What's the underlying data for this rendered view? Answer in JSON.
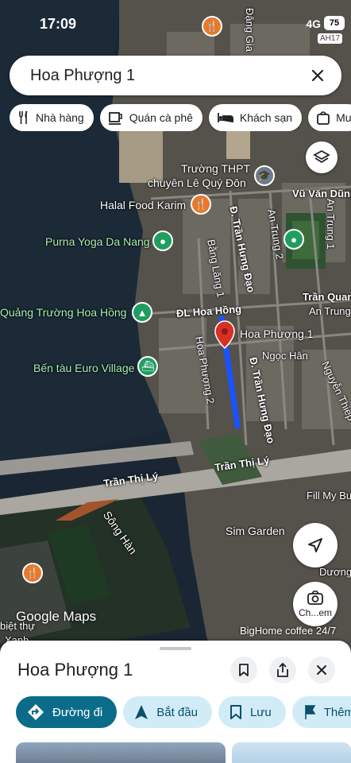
{
  "status_bar": {
    "time": "17:09",
    "network": "4G",
    "battery": "75"
  },
  "search": {
    "query": "Hoa Phượng 1"
  },
  "chips": [
    {
      "label": "Nhà hàng",
      "icon": "fork-knife-icon"
    },
    {
      "label": "Quán cà phê",
      "icon": "coffee-cup-icon"
    },
    {
      "label": "Khách sạn",
      "icon": "bed-icon"
    },
    {
      "label": "Mu",
      "icon": "shopping-bag-icon"
    }
  ],
  "map": {
    "road_badge": "AH17",
    "labels": {
      "school_1": "Trường THPT",
      "school_2": "chuyên Lê Quý Đôn",
      "halal": "Halal Food Karim",
      "yoga": "Purna Yoga Da Nang",
      "square": "Quảng Trường Hoa Hồng",
      "pier": "Bến tàu Euro Village",
      "vu_van_dung": "Vũ Văn Dũng",
      "tran_quang": "Trần Quan",
      "an_trung": "An Trung",
      "an_trung_1": "An Trung 1",
      "an_trung_2": "An Trung 2",
      "tran_hung_dao_1": "Đ. Trần Hưng Đạo",
      "tran_hung_dao_2": "Đ. Trần Hưng Đạo",
      "bang_lang": "Bằng Lăng 1",
      "hoa_hong": "ĐL Hoa Hồng",
      "ngoc_han": "Ngọc Hân",
      "hoa_phuong_2": "Hoa Phượng 2",
      "hoa_phuong_1": "Hoa Phượng 1",
      "nguyen_thiep": "Nguyễn Thiếp",
      "tran_thi_ly_1": "Trần Thị Lý",
      "tran_thi_ly_2": "Trần Thị Lý",
      "song_han": "Sông Hàn",
      "fill_my": "Fill My Bu",
      "sim_garden": "Sim Garden",
      "duong": "Dương",
      "bietthu": "biệt thự",
      "xanh": "Xanh",
      "dang_gia": "Đặng Gia"
    }
  },
  "map_buttons": {
    "lens_label": "Ch...em"
  },
  "google_maps": "Google Maps",
  "attribution": "BigHome coffee 24/7",
  "sheet": {
    "title": "Hoa Phượng 1",
    "actions": [
      {
        "label": "Đường đi",
        "icon": "directions-icon",
        "primary": true
      },
      {
        "label": "Bắt đầu",
        "icon": "navigation-arrow-icon"
      },
      {
        "label": "Lưu",
        "icon": "bookmark-icon"
      },
      {
        "label": "Thêm",
        "icon": "flag-icon"
      }
    ]
  },
  "colors": {
    "route": "#1a53ff",
    "pin": "#d93025",
    "accent": "#0b6c8a"
  }
}
